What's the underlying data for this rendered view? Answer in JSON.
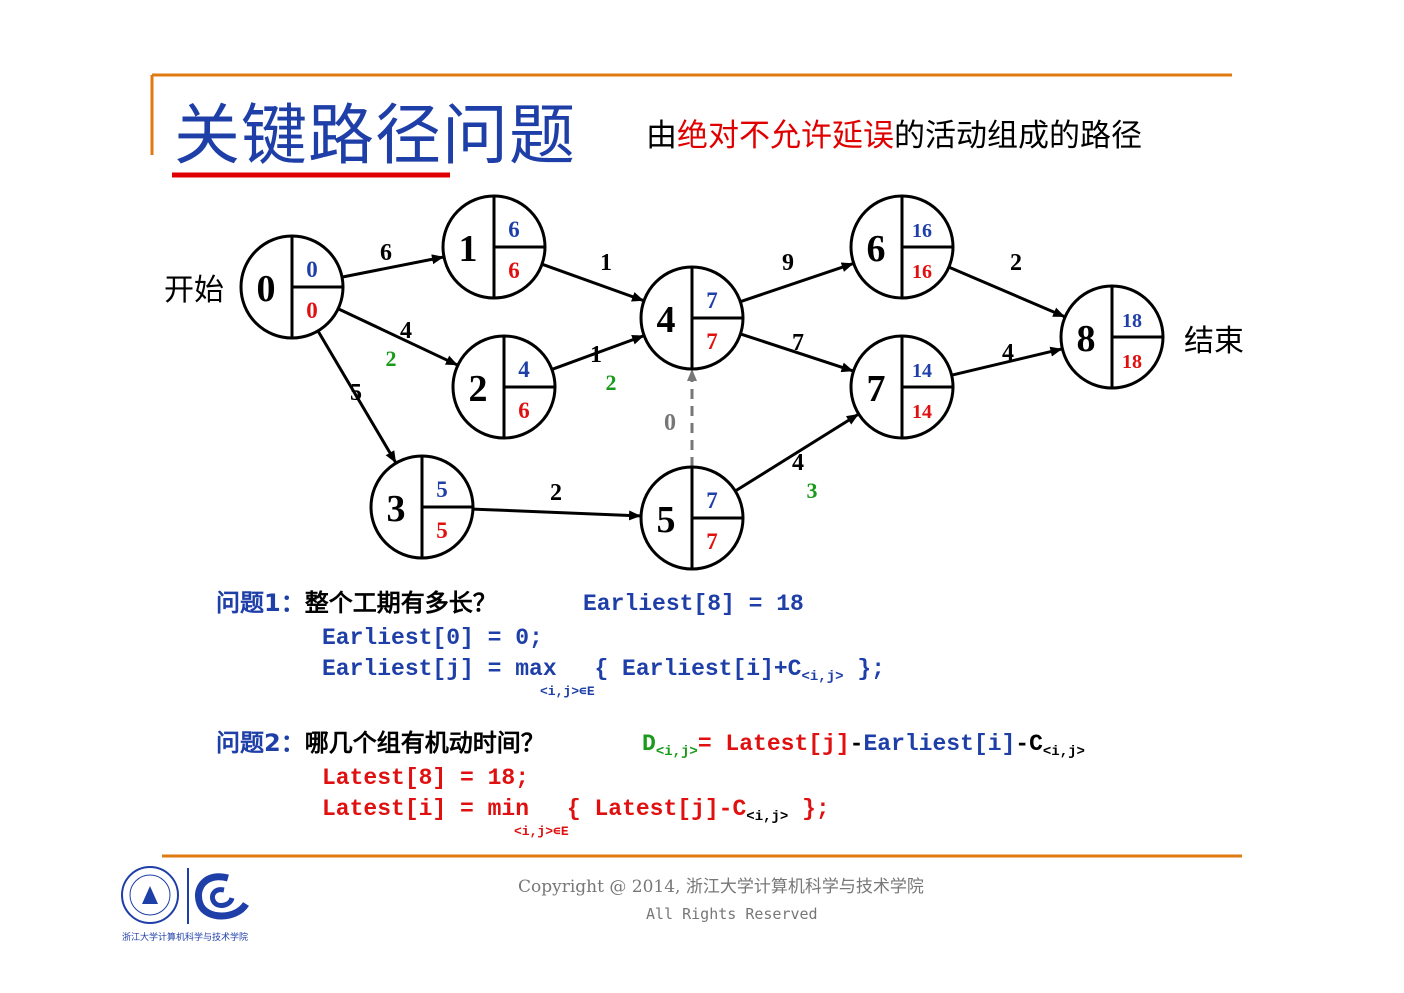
{
  "title": "关键路径问题",
  "subtitle": {
    "prefix": "由",
    "highlight": "绝对不允许延误",
    "suffix": "的活动组成的路径"
  },
  "labels": {
    "start": "开始",
    "end": "结束"
  },
  "nodes": [
    {
      "id": "0",
      "earliest": "0",
      "latest": "0"
    },
    {
      "id": "1",
      "earliest": "6",
      "latest": "6"
    },
    {
      "id": "2",
      "earliest": "4",
      "latest": "6"
    },
    {
      "id": "3",
      "earliest": "5",
      "latest": "5"
    },
    {
      "id": "4",
      "earliest": "7",
      "latest": "7"
    },
    {
      "id": "5",
      "earliest": "7",
      "latest": "7"
    },
    {
      "id": "6",
      "earliest": "16",
      "latest": "16"
    },
    {
      "id": "7",
      "earliest": "14",
      "latest": "14"
    },
    {
      "id": "8",
      "earliest": "18",
      "latest": "18"
    }
  ],
  "edges": [
    {
      "from": "0",
      "to": "1",
      "weight": "6"
    },
    {
      "from": "0",
      "to": "2",
      "weight": "4",
      "slack": "2"
    },
    {
      "from": "0",
      "to": "3",
      "weight": "5"
    },
    {
      "from": "1",
      "to": "4",
      "weight": "1"
    },
    {
      "from": "2",
      "to": "4",
      "weight": "1",
      "slack": "2"
    },
    {
      "from": "3",
      "to": "5",
      "weight": "2"
    },
    {
      "from": "5",
      "to": "4",
      "weight": "0",
      "dashed": true
    },
    {
      "from": "4",
      "to": "6",
      "weight": "9"
    },
    {
      "from": "4",
      "to": "7",
      "weight": "7"
    },
    {
      "from": "5",
      "to": "7",
      "weight": "4",
      "slack": "3"
    },
    {
      "from": "6",
      "to": "8",
      "weight": "2"
    },
    {
      "from": "7",
      "to": "8",
      "weight": "4"
    }
  ],
  "q1": {
    "head": "问题1：",
    "text": "整个工期有多长？",
    "answer": "Earliest[8] = 18",
    "line1": "Earliest[0] = 0;",
    "line2a": "Earliest[j] = max",
    "line2b": "{ Earliest[i]+C",
    "line2sub": "<i,j>",
    "line2c": " };",
    "line2under": "<i,j>∊E"
  },
  "q2": {
    "head": "问题2：",
    "text": "哪几个组有机动时间？",
    "d": "D",
    "dsub": "<i,j>",
    "eq": "= Latest[j]",
    "minus1": "-",
    "earliest": "Earliest[i]",
    "minus2": "-C",
    "csub": "<i,j>",
    "line1": "Latest[8] = 18;",
    "line2a": "Latest[i] = min",
    "line2b": "{ Latest[j]-C",
    "line2sub": "<i,j>",
    "line2c": " };",
    "line2under": "<i,j>∊E"
  },
  "footer": {
    "copyright": "Copyright @ 2014, 浙江大学计算机科学与技术学院",
    "rights": "All Rights Reserved",
    "logo_caption": "浙江大学计算机科学与技术学院"
  },
  "colors": {
    "title": "#1f3fa8",
    "accent_line": "#e07a10",
    "earliest": "#1f3fa8",
    "latest": "#e01010",
    "slack": "#1a9a1a"
  }
}
